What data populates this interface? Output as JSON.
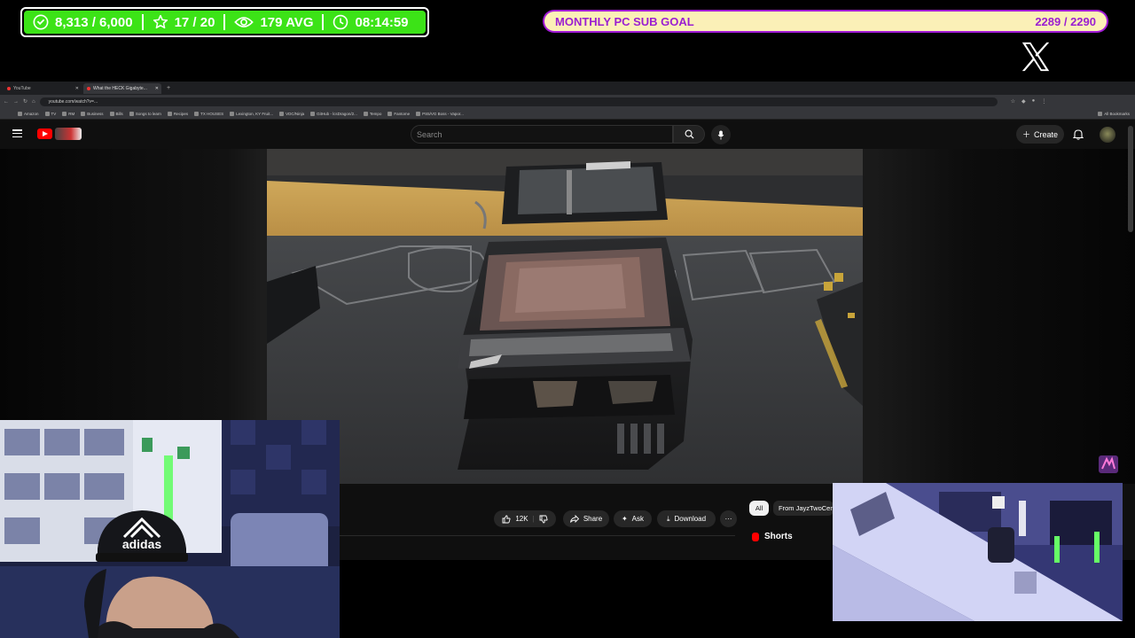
{
  "overlay": {
    "stats": {
      "followers": "8,313 / 6,000",
      "rating": "17 / 20",
      "viewers": "179 AVG",
      "uptime": "08:14:59"
    },
    "goal": {
      "label": "MONTHLY PC SUB GOAL",
      "value": "2289 / 2290"
    },
    "colors": {
      "stats_bg": "#3ce317",
      "goal_border": "#a21bd6",
      "goal_text": "#9b1ed1"
    }
  },
  "browser": {
    "tabs": [
      {
        "label": "YouTube"
      },
      {
        "label": "What the HECK Gigabyte..."
      }
    ],
    "url": "youtube.com/watch?v=...",
    "bookmarks": [
      "Amazon",
      "TV",
      "RM",
      "Business",
      "Bills",
      "Songs to learn",
      "Recipes",
      "TX HOUSES",
      "Lexington, KY Fruit...",
      "VDC/Ninja",
      "GitHub - lcsDragon/2...",
      "Tempo",
      "Fantome",
      "PS5/VG Boss - Vapor..."
    ],
    "all_bookmarks": "All Bookmarks"
  },
  "youtube": {
    "search_placeholder": "Search",
    "create_label": "Create",
    "actions": {
      "likes": "12K",
      "share": "Share",
      "ask": "Ask",
      "download": "Download"
    },
    "chips": [
      "All",
      "From JayzTwoCents"
    ],
    "shorts_label": "Shorts"
  }
}
